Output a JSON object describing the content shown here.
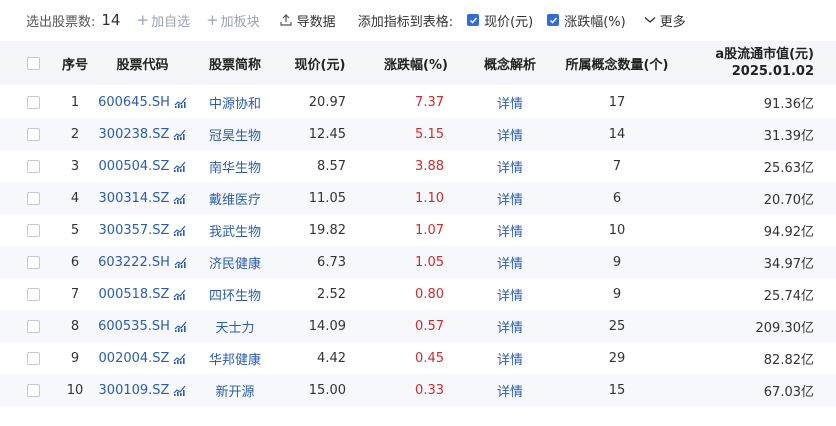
{
  "toolbar": {
    "selected_label": "选出股票数:",
    "selected_count": "14",
    "add_watchlist": "加自选",
    "add_sector": "加板块",
    "export": "导数据",
    "add_indicator_label": "添加指标到表格:",
    "check_price": "现价(元)",
    "check_change": "涨跌幅(%)",
    "more": "更多"
  },
  "columns": {
    "seq": "序号",
    "code": "股票代码",
    "name": "股票简称",
    "price": "现价(元)",
    "change": "涨跌幅(%)",
    "concept": "概念解析",
    "concept_count": "所属概念数量(个)",
    "mv_line1": "a股流通市值(元)",
    "mv_line2": "2025.01.02"
  },
  "colors": {
    "accent_blue": "#2a5db0",
    "up_red": "#d9282b",
    "checkbox_blue": "#2f6be0"
  },
  "rows": [
    {
      "seq": "1",
      "code": "600645.SH",
      "name": "中源协和",
      "price": "20.97",
      "change": "7.37",
      "detail": "详情",
      "count": "17",
      "mv": "91.36亿"
    },
    {
      "seq": "2",
      "code": "300238.SZ",
      "name": "冠昊生物",
      "price": "12.45",
      "change": "5.15",
      "detail": "详情",
      "count": "14",
      "mv": "31.39亿"
    },
    {
      "seq": "3",
      "code": "000504.SZ",
      "name": "南华生物",
      "price": "8.57",
      "change": "3.88",
      "detail": "详情",
      "count": "7",
      "mv": "25.63亿"
    },
    {
      "seq": "4",
      "code": "300314.SZ",
      "name": "戴维医疗",
      "price": "11.05",
      "change": "1.10",
      "detail": "详情",
      "count": "6",
      "mv": "20.70亿"
    },
    {
      "seq": "5",
      "code": "300357.SZ",
      "name": "我武生物",
      "price": "19.82",
      "change": "1.07",
      "detail": "详情",
      "count": "10",
      "mv": "94.92亿"
    },
    {
      "seq": "6",
      "code": "603222.SH",
      "name": "济民健康",
      "price": "6.73",
      "change": "1.05",
      "detail": "详情",
      "count": "9",
      "mv": "34.97亿"
    },
    {
      "seq": "7",
      "code": "000518.SZ",
      "name": "四环生物",
      "price": "2.52",
      "change": "0.80",
      "detail": "详情",
      "count": "9",
      "mv": "25.74亿"
    },
    {
      "seq": "8",
      "code": "600535.SH",
      "name": "天士力",
      "price": "14.09",
      "change": "0.57",
      "detail": "详情",
      "count": "25",
      "mv": "209.30亿"
    },
    {
      "seq": "9",
      "code": "002004.SZ",
      "name": "华邦健康",
      "price": "4.42",
      "change": "0.45",
      "detail": "详情",
      "count": "29",
      "mv": "82.82亿"
    },
    {
      "seq": "10",
      "code": "300109.SZ",
      "name": "新开源",
      "price": "15.00",
      "change": "0.33",
      "detail": "详情",
      "count": "15",
      "mv": "67.03亿"
    }
  ]
}
